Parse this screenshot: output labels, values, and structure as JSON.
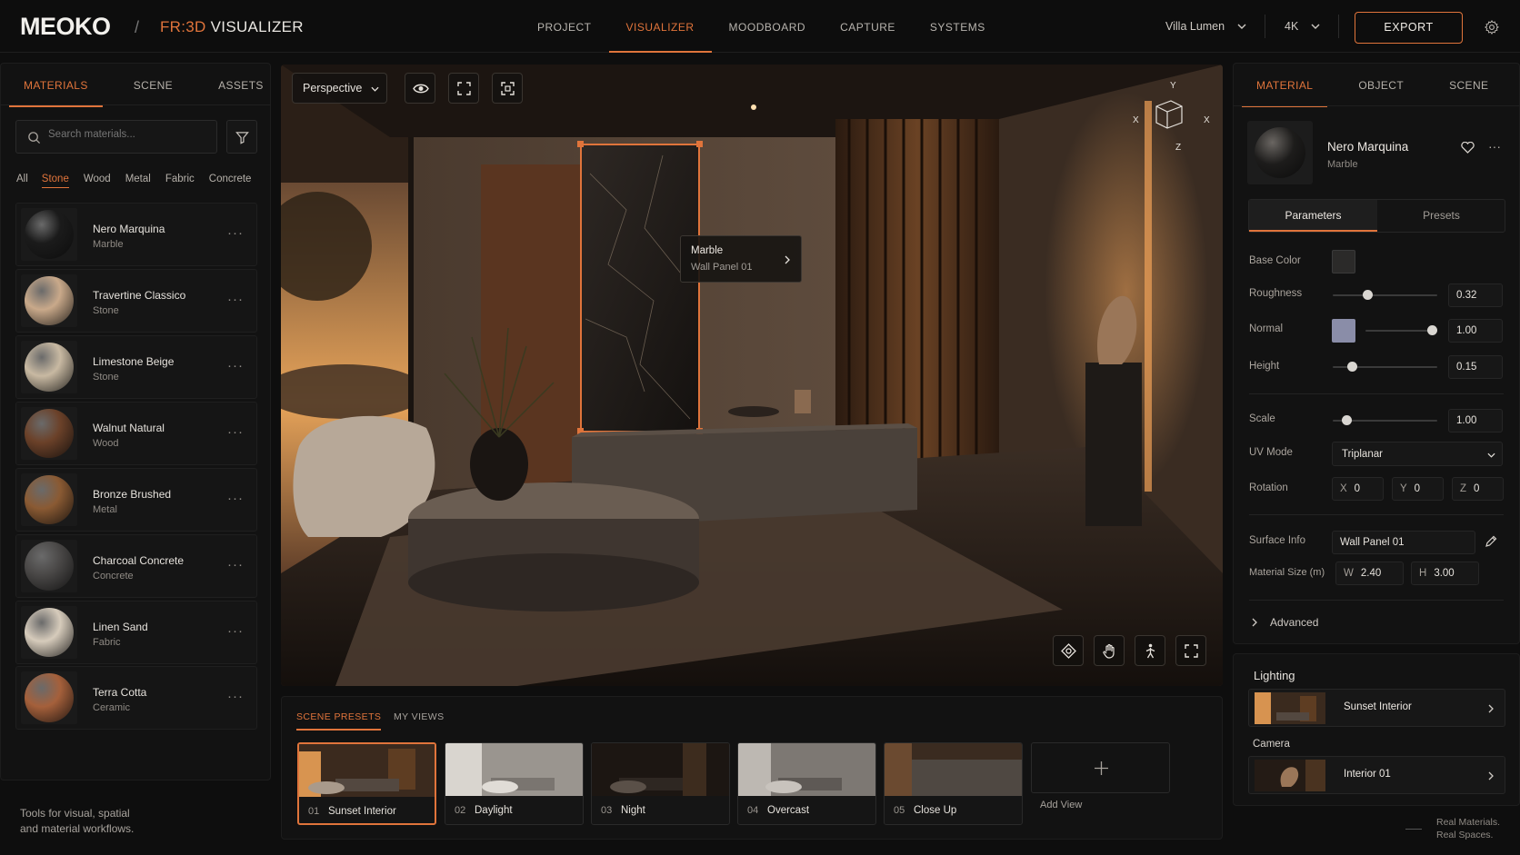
{
  "brand": {
    "logo": "MEOKO",
    "sep": "/",
    "product_accent": "FR:3D",
    "product_name": "VISUALIZER"
  },
  "nav": [
    "PROJECT",
    "VISUALIZER",
    "MOODBOARD",
    "CAPTURE",
    "SYSTEMS"
  ],
  "nav_active": "VISUALIZER",
  "project_select": "Villa Lumen",
  "resolution_select": "4K",
  "export_label": "EXPORT",
  "left": {
    "tabs": [
      "MATERIALS",
      "SCENE",
      "ASSETS"
    ],
    "search_placeholder": "Search materials...",
    "filters": [
      "All",
      "Stone",
      "Wood",
      "Metal",
      "Fabric",
      "Concrete"
    ],
    "active_filter": "Stone",
    "materials": [
      {
        "name": "Nero Marquina",
        "type": "Marble",
        "color": "#1b1b1b"
      },
      {
        "name": "Travertine Classico",
        "type": "Stone",
        "color": "#c9a98a"
      },
      {
        "name": "Limestone Beige",
        "type": "Stone",
        "color": "#c8b9a2"
      },
      {
        "name": "Walnut Natural",
        "type": "Wood",
        "color": "#6b4129"
      },
      {
        "name": "Bronze Brushed",
        "type": "Metal",
        "color": "#8a5a33"
      },
      {
        "name": "Charcoal Concrete",
        "type": "Concrete",
        "color": "#4a4847"
      },
      {
        "name": "Linen Sand",
        "type": "Fabric",
        "color": "#d6cbbb"
      },
      {
        "name": "Terra Cotta",
        "type": "Ceramic",
        "color": "#a5603b"
      }
    ],
    "footer": [
      "Tools for visual, spatial",
      "and material workflows."
    ]
  },
  "viewport": {
    "view_mode": "Perspective",
    "tooltip_title": "Marble",
    "tooltip_sub": "Wall Panel 01",
    "gizmo": {
      "y": "Y",
      "x1": "X",
      "x2": "X",
      "z": "Z"
    }
  },
  "presets": {
    "tabs": [
      "SCENE PRESETS",
      "MY VIEWS"
    ],
    "items": [
      {
        "num": "01",
        "name": "Sunset Interior"
      },
      {
        "num": "02",
        "name": "Daylight"
      },
      {
        "num": "03",
        "name": "Night"
      },
      {
        "num": "04",
        "name": "Overcast"
      },
      {
        "num": "05",
        "name": "Close Up"
      }
    ],
    "add_label": "Add View"
  },
  "right": {
    "tabs": [
      "MATERIAL",
      "OBJECT",
      "SCENE"
    ],
    "material_name": "Nero Marquina",
    "material_type": "Marble",
    "subtabs": [
      "Parameters",
      "Presets"
    ],
    "params": {
      "base_color": "Base Color",
      "roughness": {
        "label": "Roughness",
        "value": "0.32",
        "level": 0.32
      },
      "normal": {
        "label": "Normal",
        "value": "1.00",
        "level": 1.0
      },
      "height": {
        "label": "Height",
        "value": "0.15",
        "level": 0.15
      },
      "scale": {
        "label": "Scale",
        "value": "1.00",
        "level": 0.1
      },
      "uv_mode": {
        "label": "UV Mode",
        "value": "Triplanar"
      },
      "rotation": {
        "label": "Rotation",
        "x": "0",
        "y": "0",
        "z": "0"
      },
      "surface_info": {
        "label": "Surface Info",
        "value": "Wall Panel 01"
      },
      "material_size": {
        "label": "Material Size (m)",
        "w": "2.40",
        "h": "3.00"
      },
      "advanced": "Advanced"
    },
    "lighting_title": "Lighting",
    "lighting_value": "Sunset Interior",
    "camera_title": "Camera",
    "camera_value": "Interior 01",
    "tagline": [
      "Real Materials.",
      "Real Spaces."
    ]
  },
  "colors": {
    "accent": "#e0743b"
  }
}
